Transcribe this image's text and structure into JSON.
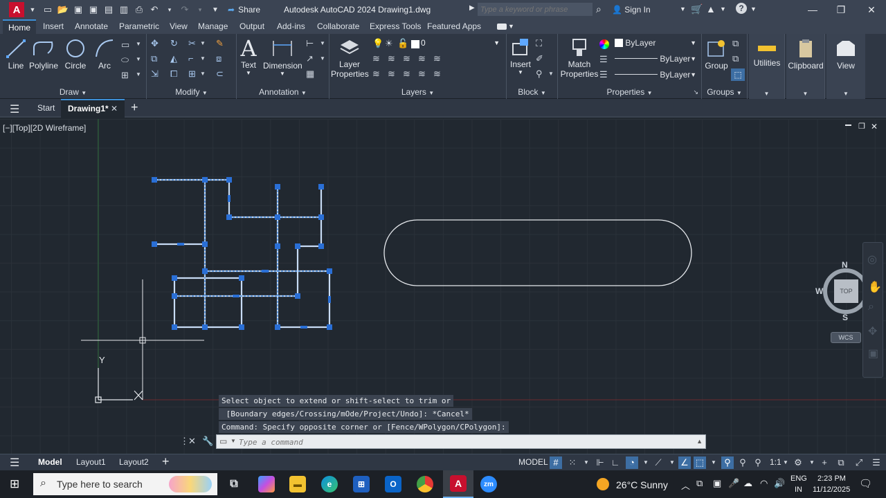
{
  "app": {
    "title": "Autodesk AutoCAD 2024   Drawing1.dwg",
    "logo_letter": "A",
    "share_label": "Share",
    "search_placeholder": "Type a keyword or phrase",
    "signin_label": "Sign In"
  },
  "ribbon_tabs": [
    "Home",
    "Insert",
    "Annotate",
    "Parametric",
    "View",
    "Manage",
    "Output",
    "Add-ins",
    "Collaborate",
    "Express Tools",
    "Featured Apps"
  ],
  "ribbon": {
    "draw": {
      "label": "Draw",
      "tools": [
        "Line",
        "Polyline",
        "Circle",
        "Arc"
      ]
    },
    "modify": {
      "label": "Modify"
    },
    "annotation": {
      "label": "Annotation",
      "tools": [
        "Text",
        "Dimension"
      ]
    },
    "layers": {
      "label": "Layers",
      "layer_props_1": "Layer",
      "layer_props_2": "Properties",
      "current_layer": "0"
    },
    "block": {
      "label": "Block",
      "insert": "Insert"
    },
    "properties": {
      "label": "Properties",
      "match_1": "Match",
      "match_2": "Properties",
      "color": "ByLayer",
      "lineweight": "ByLayer",
      "linetype": "ByLayer"
    },
    "groups": {
      "label": "Groups",
      "group": "Group"
    },
    "utilities": "Utilities",
    "clipboard": "Clipboard",
    "view": "View"
  },
  "file_tabs": {
    "start": "Start",
    "drawing": "Drawing1*"
  },
  "viewport": {
    "label": "[−][Top][2D Wireframe]",
    "navcube": {
      "n": "N",
      "s": "S",
      "e": "E",
      "w": "W",
      "top": "TOP",
      "wcs": "WCS"
    },
    "ucs_y": "Y"
  },
  "command": {
    "history": [
      "Select object to extend or shift-select to trim or",
      " [Boundary edges/Crossing/mOde/Project/Undo]: *Cancel*",
      "Command: Specify opposite corner or [Fence/WPolygon/CPolygon]:"
    ],
    "placeholder": "Type a command"
  },
  "layout_tabs": [
    "Model",
    "Layout1",
    "Layout2"
  ],
  "status": {
    "model": "MODEL",
    "scale": "1:1"
  },
  "taskbar": {
    "search_placeholder": "Type here to search",
    "weather": "26°C  Sunny",
    "lang_1": "ENG",
    "lang_2": "IN",
    "time": "2:23 PM",
    "date": "11/12/2025"
  },
  "colors": {
    "accent": "#3d8fd6",
    "selection": "#2f7fe0",
    "grip": "#2a6fd6",
    "autocad_red": "#c8102e"
  }
}
